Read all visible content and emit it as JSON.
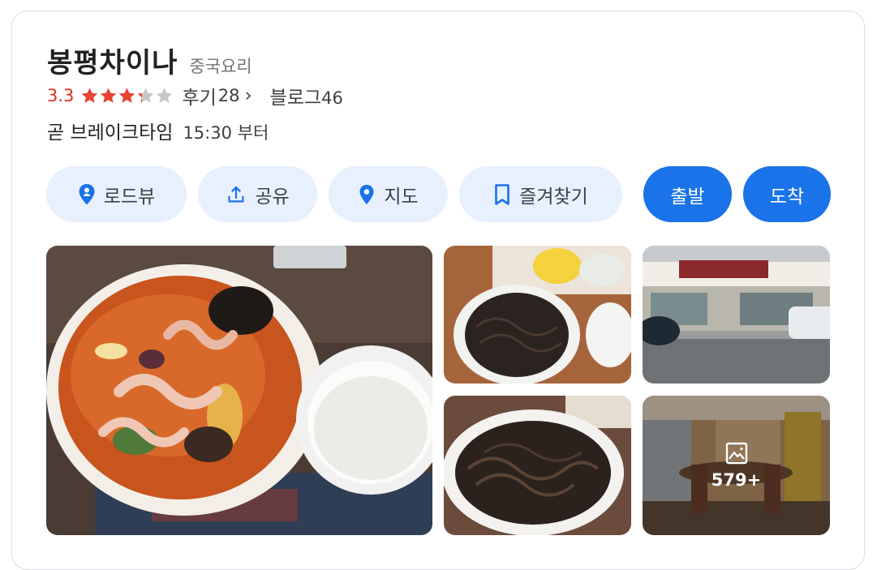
{
  "place": {
    "name": "봉평차이나",
    "category": "중국요리",
    "rating": "3.3",
    "rating_value": 3.3,
    "rating_max": 5,
    "review_label": "후기",
    "review_count": "28",
    "review_chevron": "›",
    "blog_label": "블로그",
    "blog_count": "46",
    "hours_status": "곧 브레이크타임",
    "hours_time": "15:30 부터"
  },
  "colors": {
    "rating": "#d93025",
    "star_filled": "#ea4335",
    "star_empty": "#c6c6c6",
    "accent": "#1a73e8",
    "chip_bg": "#e8f0fe"
  },
  "actions": [
    {
      "label": "로드뷰",
      "icon": "roadview-pin-icon"
    },
    {
      "label": "공유",
      "icon": "share-icon"
    },
    {
      "label": "지도",
      "icon": "map-pin-icon"
    },
    {
      "label": "즐겨찾기",
      "icon": "bookmark-icon"
    },
    {
      "label": "출발",
      "icon": ""
    },
    {
      "label": "도착",
      "icon": ""
    }
  ],
  "photos": {
    "main": "jjamppong-photo",
    "top_middle": "jjajangmyeon-photo",
    "top_right": "storefront-photo",
    "bottom_middle": "fried-noodle-photo",
    "bottom_right": "interior-photo",
    "more_icon": "gallery-icon",
    "more_count": "579+"
  }
}
